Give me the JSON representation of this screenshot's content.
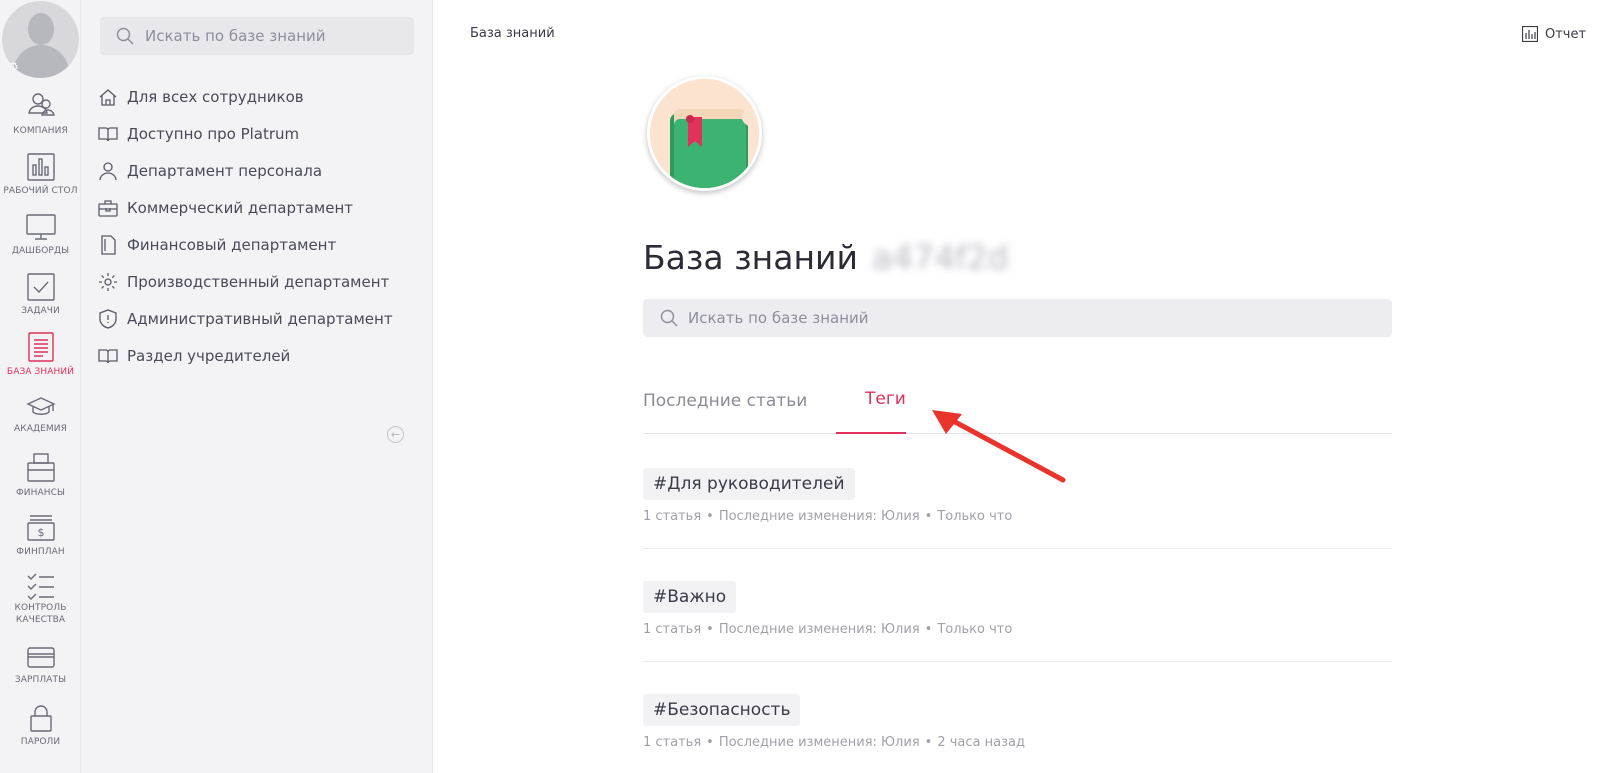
{
  "rail": {
    "items": [
      {
        "label": "КОМПАНИЯ",
        "icon": "people-icon"
      },
      {
        "label": "РАБОЧИЙ СТОЛ",
        "icon": "bar-chart-icon"
      },
      {
        "label": "ДАШБОРДЫ",
        "icon": "monitor-icon"
      },
      {
        "label": "ЗАДАЧИ",
        "icon": "checkbox-icon"
      },
      {
        "label": "БАЗА ЗНАНИЙ",
        "icon": "document-icon",
        "active": true
      },
      {
        "label": "АКАДЕМИЯ",
        "icon": "graduation-cap-icon"
      },
      {
        "label": "ФИНАНСЫ",
        "icon": "wallet-icon"
      },
      {
        "label": "ФИНПЛАН",
        "icon": "money-icon"
      },
      {
        "label_line1": "КОНТРОЛЬ",
        "label_line2": "КАЧЕСТВА",
        "icon": "checklist-icon"
      },
      {
        "label": "ЗАРПЛАТЫ",
        "icon": "card-icon"
      },
      {
        "label": "ПАРОЛИ",
        "icon": "lock-icon"
      }
    ]
  },
  "sidebar": {
    "search_placeholder": "Искать по базе знаний",
    "items": [
      {
        "label": "Для всех сотрудников",
        "icon": "home-icon"
      },
      {
        "label": "Доступно про Platrum",
        "icon": "book-icon"
      },
      {
        "label": "Департамент персонала",
        "icon": "person-icon"
      },
      {
        "label": "Коммерческий департамент",
        "icon": "briefcase-icon"
      },
      {
        "label": "Финансовый департамент",
        "icon": "file-icon"
      },
      {
        "label": "Производственный департамент",
        "icon": "gear-icon"
      },
      {
        "label": "Административный департамент",
        "icon": "shield-icon"
      },
      {
        "label": "Раздел учредителей",
        "icon": "book-icon"
      }
    ]
  },
  "header": {
    "breadcrumb": "База знаний",
    "report_label": "Отчет"
  },
  "main": {
    "title": "База знаний",
    "title_suffix": "a474f2d",
    "search_placeholder": "Искать по базе знаний",
    "tabs": [
      {
        "label": "Последние статьи",
        "active": false
      },
      {
        "label": "Теги",
        "active": true
      }
    ],
    "tags": [
      {
        "name": "#Для руководителей",
        "count": "1 статья",
        "changes": "Последние изменения: Юлия",
        "time": "Только что"
      },
      {
        "name": "#Важно",
        "count": "1 статья",
        "changes": "Последние изменения: Юлия",
        "time": "Только что"
      },
      {
        "name": "#Безопасность",
        "count": "1 статья",
        "changes": "Последние изменения: Юлия",
        "time": "2 часа назад"
      }
    ]
  },
  "colors": {
    "accent": "#e0325b",
    "arrow": "#e8342c"
  }
}
